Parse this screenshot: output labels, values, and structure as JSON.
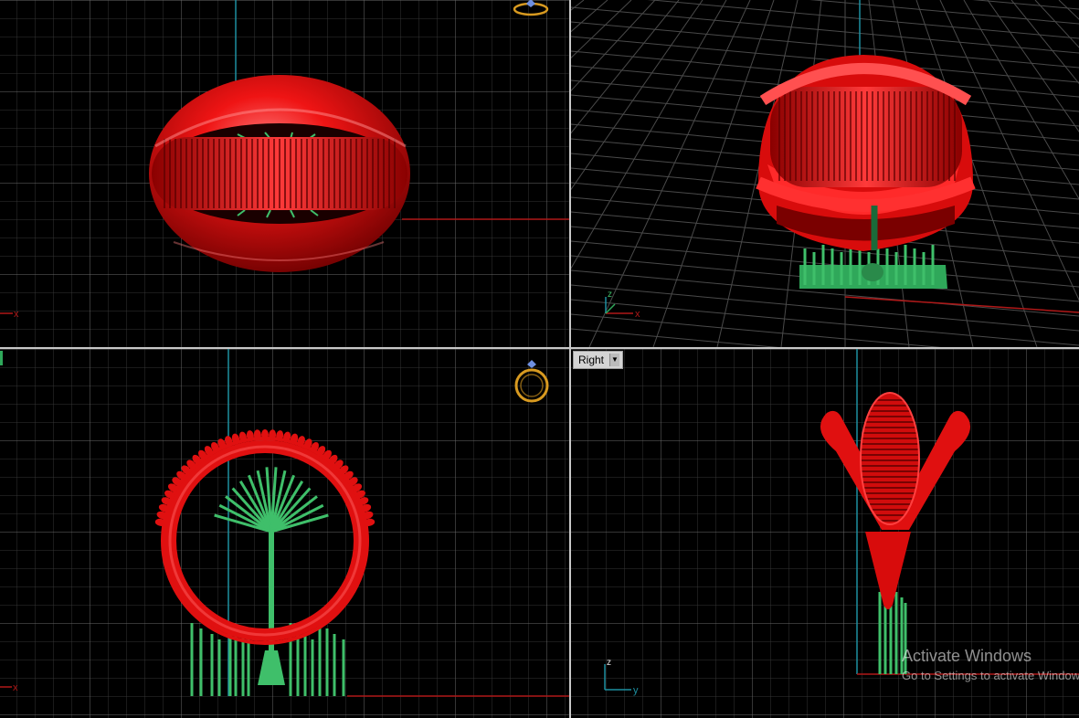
{
  "viewports": {
    "right_label": "Right"
  },
  "axes": {
    "x": "x",
    "y": "y",
    "z": "z"
  },
  "watermark": {
    "title": "Activate Windows",
    "subtitle": "Go to Settings to activate Windows."
  },
  "colors": {
    "background": "#000000",
    "grid_minor": "#3a3a3a",
    "grid_major": "#6a6a6a",
    "axis_x": "#b01818",
    "axis_y": "#1e8fa0",
    "ring": "#e01010",
    "supports": "#3fbf6a",
    "widget": "#d89a20"
  },
  "icons": [
    "gem-ring-icon",
    "axis-triad-icon",
    "dropdown-arrow-icon"
  ]
}
